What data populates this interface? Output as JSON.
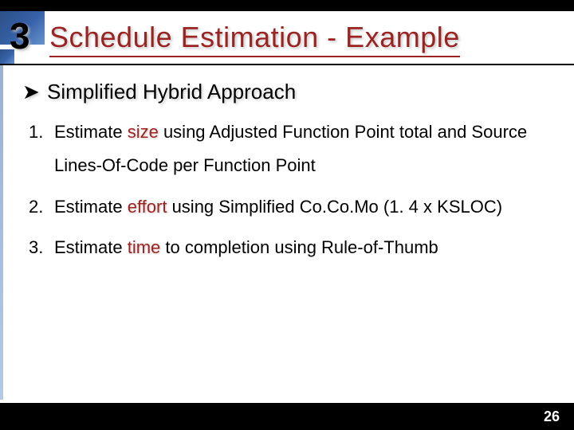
{
  "chapter_number": "3",
  "title": "Schedule Estimation - Example",
  "subheading": "Simplified Hybrid Approach",
  "steps": [
    {
      "pre": "Estimate ",
      "kw": "size",
      "post": " using Adjusted Function Point total and Source Lines-Of-Code per Function Point"
    },
    {
      "pre": "Estimate ",
      "kw": "effort",
      "post": " using Simplified Co.Co.Mo (1. 4 x KSLOC)"
    },
    {
      "pre": "Estimate ",
      "kw": "time",
      "post": " to completion using Rule-of-Thumb"
    }
  ],
  "page_number": "26"
}
